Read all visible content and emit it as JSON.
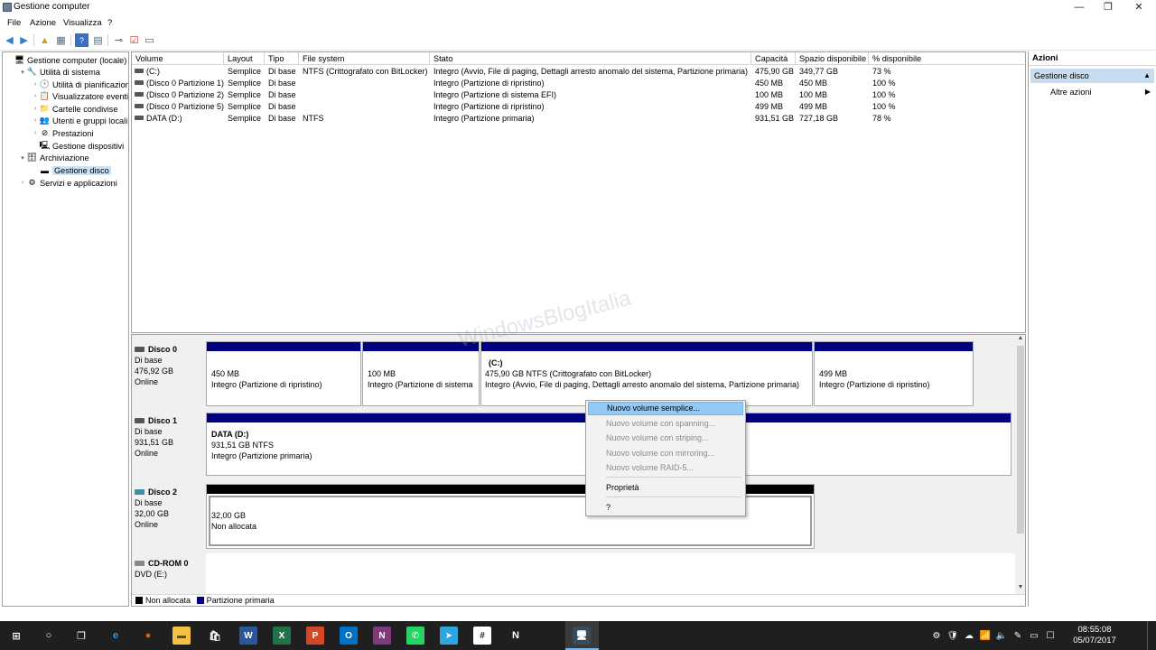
{
  "window": {
    "title": "Gestione computer",
    "minimize": "—",
    "maximize": "❐",
    "close": "✕"
  },
  "menu": [
    "File",
    "Azione",
    "Visualizza",
    "?"
  ],
  "tree": {
    "items": [
      {
        "label": "Gestione computer (locale)",
        "level": 0,
        "exp": "",
        "icon": "computer-management-icon",
        "glyph": "🖥"
      },
      {
        "label": "Utilità di sistema",
        "level": 1,
        "exp": "▾",
        "icon": "system-tools-icon",
        "glyph": "🔧"
      },
      {
        "label": "Utilità di pianificazione",
        "level": 2,
        "exp": "›",
        "icon": "task-scheduler-icon",
        "glyph": "🕒"
      },
      {
        "label": "Visualizzatore eventi",
        "level": 2,
        "exp": "›",
        "icon": "event-viewer-icon",
        "glyph": "📋"
      },
      {
        "label": "Cartelle condivise",
        "level": 2,
        "exp": "›",
        "icon": "shared-folders-icon",
        "glyph": "📁"
      },
      {
        "label": "Utenti e gruppi locali",
        "level": 2,
        "exp": "›",
        "icon": "users-groups-icon",
        "glyph": "👥"
      },
      {
        "label": "Prestazioni",
        "level": 2,
        "exp": "›",
        "icon": "performance-icon",
        "glyph": "⊘"
      },
      {
        "label": "Gestione dispositivi",
        "level": 2,
        "exp": "",
        "icon": "device-manager-icon",
        "glyph": "🖳"
      },
      {
        "label": "Archiviazione",
        "level": 1,
        "exp": "▾",
        "icon": "storage-icon",
        "glyph": "🗄"
      },
      {
        "label": "Gestione disco",
        "level": 2,
        "exp": "",
        "icon": "disk-management-icon",
        "glyph": "▬",
        "selected": true
      },
      {
        "label": "Servizi e applicazioni",
        "level": 1,
        "exp": "›",
        "icon": "services-apps-icon",
        "glyph": "⚙"
      }
    ]
  },
  "volumes": {
    "columns": [
      "Volume",
      "Layout",
      "Tipo",
      "File system",
      "Stato",
      "Capacità",
      "Spazio disponibile",
      "% disponibile"
    ],
    "rows": [
      [
        "(C:)",
        "Semplice",
        "Di base",
        "NTFS (Crittografato con BitLocker)",
        "Integro (Avvio, File di paging, Dettagli arresto anomalo del sistema, Partizione primaria)",
        "475,90 GB",
        "349,77 GB",
        "73 %"
      ],
      [
        "(Disco 0 Partizione 1)",
        "Semplice",
        "Di base",
        "",
        "Integro (Partizione di ripristino)",
        "450 MB",
        "450 MB",
        "100 %"
      ],
      [
        "(Disco 0 Partizione 2)",
        "Semplice",
        "Di base",
        "",
        "Integro (Partizione di sistema EFI)",
        "100 MB",
        "100 MB",
        "100 %"
      ],
      [
        "(Disco 0 Partizione 5)",
        "Semplice",
        "Di base",
        "",
        "Integro (Partizione di ripristino)",
        "499 MB",
        "499 MB",
        "100 %"
      ],
      [
        "DATA (D:)",
        "Semplice",
        "Di base",
        "NTFS",
        "Integro (Partizione primaria)",
        "931,51 GB",
        "727,18 GB",
        "78 %"
      ]
    ]
  },
  "disks": {
    "disk0": {
      "name": "Disco 0",
      "type": "Di base",
      "size": "476,92 GB",
      "status": "Online",
      "parts": [
        {
          "title": "",
          "l1": "450 MB",
          "l2": "Integro (Partizione di ripristino)"
        },
        {
          "title": "",
          "l1": "100 MB",
          "l2": "Integro (Partizione di sistema"
        },
        {
          "title": "(C:)",
          "l1": "475,90 GB NTFS (Crittografato con BitLocker)",
          "l2": "Integro (Avvio, File di paging, Dettagli arresto anomalo del sistema, Partizione primaria)"
        },
        {
          "title": "",
          "l1": "499 MB",
          "l2": "Integro (Partizione di ripristino)"
        }
      ]
    },
    "disk1": {
      "name": "Disco 1",
      "type": "Di base",
      "size": "931,51 GB",
      "status": "Online",
      "parts": [
        {
          "title": "DATA  (D:)",
          "l1": "931,51 GB NTFS",
          "l2": "Integro (Partizione primaria)"
        }
      ]
    },
    "disk2": {
      "name": "Disco 2",
      "type": "Di base",
      "size": "32,00 GB",
      "status": "Online",
      "parts": [
        {
          "l1": "32,00 GB",
          "l2": "Non allocata"
        }
      ]
    },
    "cdrom0": {
      "name": "CD-ROM 0",
      "type": "DVD (E:)"
    }
  },
  "legend": {
    "unallocated": "Non allocata",
    "primary": "Partizione primaria",
    "unallocated_color": "#000000",
    "primary_color": "#000080"
  },
  "watermark": "WindowsBlogItalia",
  "actions": {
    "header": "Azioni",
    "section": "Gestione disco",
    "item": "Altre azioni"
  },
  "context_menu": [
    {
      "label": "Nuovo volume semplice...",
      "state": "highlighted"
    },
    {
      "label": "Nuovo volume con spanning...",
      "state": "disabled"
    },
    {
      "label": "Nuovo volume con striping...",
      "state": "disabled"
    },
    {
      "label": "Nuovo volume con mirroring...",
      "state": "disabled"
    },
    {
      "label": "Nuovo volume RAID-5...",
      "state": "disabled"
    },
    {
      "label": "Proprietà",
      "state": "enabled"
    },
    {
      "label": "?",
      "state": "enabled"
    }
  ],
  "taskbar": {
    "apps": [
      {
        "name": "start-button",
        "glyph": "⊞",
        "bg": "",
        "fg": "#ffffff"
      },
      {
        "name": "cortana-button",
        "glyph": "○",
        "bg": "",
        "fg": "#ffffff"
      },
      {
        "name": "task-view-button",
        "glyph": "❐",
        "bg": "",
        "fg": "#ffffff"
      },
      {
        "name": "edge-icon",
        "glyph": "e",
        "bg": "",
        "fg": "#3a96dd"
      },
      {
        "name": "firefox-icon",
        "glyph": "●",
        "bg": "",
        "fg": "#e66000"
      },
      {
        "name": "file-explorer-icon",
        "glyph": "▬",
        "bg": "#f3c145",
        "fg": "#6b4f00"
      },
      {
        "name": "store-icon",
        "glyph": "🛍",
        "bg": "",
        "fg": "#ffffff"
      },
      {
        "name": "word-icon",
        "glyph": "W",
        "bg": "#2b579a",
        "fg": "#ffffff"
      },
      {
        "name": "excel-icon",
        "glyph": "X",
        "bg": "#217346",
        "fg": "#ffffff"
      },
      {
        "name": "powerpoint-icon",
        "glyph": "P",
        "bg": "#d24726",
        "fg": "#ffffff"
      },
      {
        "name": "outlook-icon",
        "glyph": "O",
        "bg": "#0072c6",
        "fg": "#ffffff"
      },
      {
        "name": "onenote-icon",
        "glyph": "N",
        "bg": "#80397b",
        "fg": "#ffffff"
      },
      {
        "name": "whatsapp-icon",
        "glyph": "✆",
        "bg": "#25d366",
        "fg": "#ffffff"
      },
      {
        "name": "telegram-icon",
        "glyph": "➤",
        "bg": "#2ca5e0",
        "fg": "#ffffff"
      },
      {
        "name": "slack-icon",
        "glyph": "#",
        "bg": "#ffffff",
        "fg": "#1f1f1f"
      },
      {
        "name": "notion-icon",
        "glyph": "N",
        "bg": "",
        "fg": "#ffffff"
      },
      {
        "name": "computer-management-taskbar-icon",
        "glyph": "🖥",
        "bg": "#3a4a5e",
        "fg": "#ffffff"
      }
    ],
    "tray": [
      "⚙",
      "🛡",
      "☁",
      "📶",
      "🔈",
      "✎",
      "▭",
      "☐"
    ],
    "time": "08:55:08",
    "date": "05/07/2017"
  }
}
